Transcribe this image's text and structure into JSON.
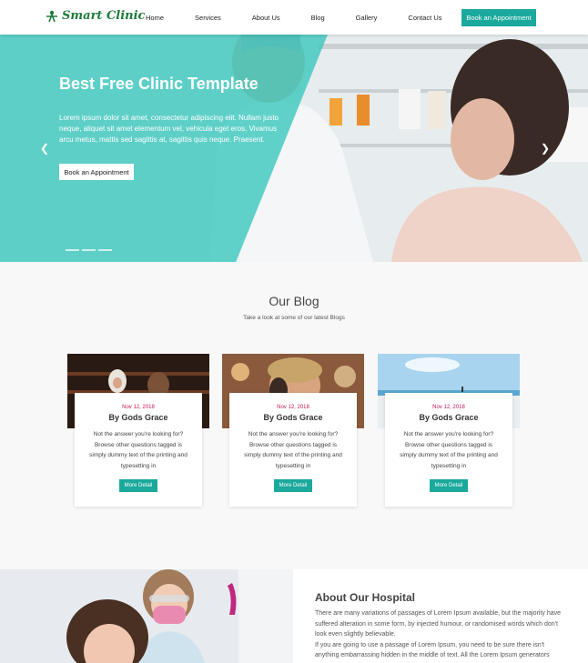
{
  "brand": {
    "name": "Smart Clinic"
  },
  "nav": {
    "items": [
      "Home",
      "Services",
      "About Us",
      "Blog",
      "Gallery",
      "Contact Us"
    ],
    "cta": "Book an Appointment"
  },
  "hero": {
    "title": "Best Free Clinic Template",
    "text": "Lorem ipsum dolor sit amet, consectetur adipiscing elit. Nullam justo neque, aliquet sit amet elementum vel, vehicula eget eros. Vivamus arcu metus, mattis sed sagittis at, sagittis quis neque. Praesent.",
    "cta": "Book an Appointment",
    "prev_icon": "chevron-left-icon",
    "next_icon": "chevron-right-icon"
  },
  "blog": {
    "title": "Our Blog",
    "subtitle": "Take a look at some of our latest Blogs",
    "cards": [
      {
        "date": "Nov 12, 2018",
        "title": "By Gods Grace",
        "text": "Not the answer you're looking for? Browse other questions tagged is simply dummy text of the printing and typesetting in",
        "button": "More Detail"
      },
      {
        "date": "Nov 12, 2018",
        "title": "By Gods Grace",
        "text": "Not the answer you're looking for? Browse other questions tagged is simply dummy text of the printing and typesetting in",
        "button": "More Detail"
      },
      {
        "date": "Nov 12, 2018",
        "title": "By Gods Grace",
        "text": "Not the answer you're looking for? Browse other questions tagged is simply dummy text of the printing and typesetting in",
        "button": "More Detail"
      }
    ]
  },
  "about": {
    "title": "About Our Hospital",
    "p1": "There are many variations of passages of Lorem Ipsum available, but the majority have suffered alteration in some form, by injected humour, or randomised words which don't look even slightly believable.",
    "p2": "If you are going to use a passage of Lorem Ipsum, you need to be sure there isn't anything embarrassing hidden in the middle of text. All the Lorem Ipsum generators"
  },
  "colors": {
    "accent": "#1aa99c",
    "hero_overlay": "#40c8be",
    "date": "#c2185b"
  }
}
